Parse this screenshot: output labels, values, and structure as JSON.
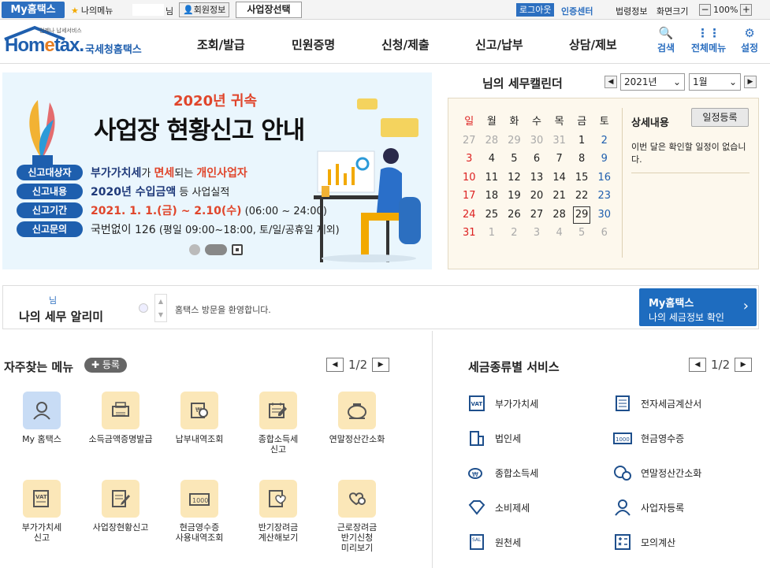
{
  "topbar": {
    "my_hometax": "My홈택스",
    "my_menu": "나의메뉴",
    "nim": "님",
    "member_info": "회원정보",
    "biz_select": "사업장선택",
    "logout": "로그아웃",
    "cert_center": "인증센터",
    "law_info": "법령정보",
    "screen_size": "화면크기",
    "zoom_minus": "−",
    "zoom_value": "100%",
    "zoom_plus": "+"
  },
  "header": {
    "logo_small": "언제나 납세서비스",
    "logo_main_a": "Hom",
    "logo_main_e": "e",
    "logo_main_b": "tax.",
    "logo_kr": "국세청홈택스",
    "nav": [
      "조회/발급",
      "민원증명",
      "신청/제출",
      "신고/납부",
      "상담/제보"
    ],
    "icons": [
      {
        "label": "검색",
        "glyph": "🔍"
      },
      {
        "label": "전체메뉴",
        "glyph": "⋮⋮"
      },
      {
        "label": "설정",
        "glyph": "⚙"
      }
    ]
  },
  "banner": {
    "sub": "2020년 귀속",
    "title": "사업장 현황신고 안내",
    "rows": [
      {
        "pill": "신고대상자",
        "a": "부가가치세",
        "b": "가 ",
        "c": "면세",
        "d": "되는 ",
        "e": "개인사업자"
      },
      {
        "pill": "신고내용",
        "a": "2020년 수입금액",
        "b": " 등 사업실적"
      },
      {
        "pill": "신고기간",
        "a": "2021. 1. 1.(금) ~ 2.10(수)",
        "b": " (06:00 ~ 24:00)"
      },
      {
        "pill": "신고문의",
        "a": "국번없이 126",
        "b": " (평일 09:00~18:00, 토/일/공휴일 제외)"
      }
    ]
  },
  "calendar": {
    "title": "님의 세무캘린더",
    "year": "2021년",
    "month": "1월",
    "prev": "◀",
    "next": "▶",
    "headers": [
      "일",
      "월",
      "화",
      "수",
      "목",
      "금",
      "토"
    ],
    "weeks": [
      [
        "27",
        "28",
        "29",
        "30",
        "31",
        "1",
        "2"
      ],
      [
        "3",
        "4",
        "5",
        "6",
        "7",
        "8",
        "9"
      ],
      [
        "10",
        "11",
        "12",
        "13",
        "14",
        "15",
        "16"
      ],
      [
        "17",
        "18",
        "19",
        "20",
        "21",
        "22",
        "23"
      ],
      [
        "24",
        "25",
        "26",
        "27",
        "28",
        "29",
        "30"
      ],
      [
        "31",
        "1",
        "2",
        "3",
        "4",
        "5",
        "6"
      ]
    ],
    "today": "29",
    "detail_title": "상세내용",
    "schedule_btn": "일정등록",
    "detail_text": "이번 달은 확인할 일정이 없습니다."
  },
  "alert": {
    "nim": "님",
    "title": "나의 세무 알리미",
    "message": "홈택스 방문을 환영합니다.",
    "up": "▲",
    "down": "▼",
    "mytax_a": "My홈택스",
    "mytax_b": "나의 세금정보 확인",
    "mytax_arrow": "›"
  },
  "fav": {
    "title": "자주찾는 메뉴",
    "register": "✚ 등록",
    "page": "1/2",
    "prev": "◀",
    "next": "▶",
    "items": [
      {
        "label": "My 홈택스",
        "icon": "person-icon"
      },
      {
        "label": "소득금액증명발급",
        "icon": "printer-icon"
      },
      {
        "label": "납부내역조회",
        "icon": "won-search-icon"
      },
      {
        "label": "종합소득세\n신고",
        "icon": "calendar-pen-icon"
      },
      {
        "label": "연말정산간소화",
        "icon": "piggy-icon"
      },
      {
        "label": "부가가치세\n신고",
        "icon": "vat-doc-icon"
      },
      {
        "label": "사업장현황신고",
        "icon": "doc-pen-icon"
      },
      {
        "label": "현금영수증\n사용내역조회",
        "icon": "money-icon"
      },
      {
        "label": "반기장려금\n계산해보기",
        "icon": "hand-heart-icon"
      },
      {
        "label": "근로장려금\n반기신청\n미리보기",
        "icon": "heart-search-icon"
      }
    ]
  },
  "services": {
    "title": "세금종류별 서비스",
    "page": "1/2",
    "prev": "◀",
    "next": "▶",
    "left": [
      "부가가치세",
      "법인세",
      "종합소득세",
      "소비제세",
      "원천세"
    ],
    "right": [
      "전자세금계산서",
      "현금영수증",
      "연말정산간소화",
      "사업자등록",
      "모의계산"
    ]
  },
  "colors": {
    "brand": "#2c6fc0",
    "accent": "#e0452b",
    "banner_bg": "#eaf6fd",
    "calendar_bg": "#fdf8ed"
  }
}
